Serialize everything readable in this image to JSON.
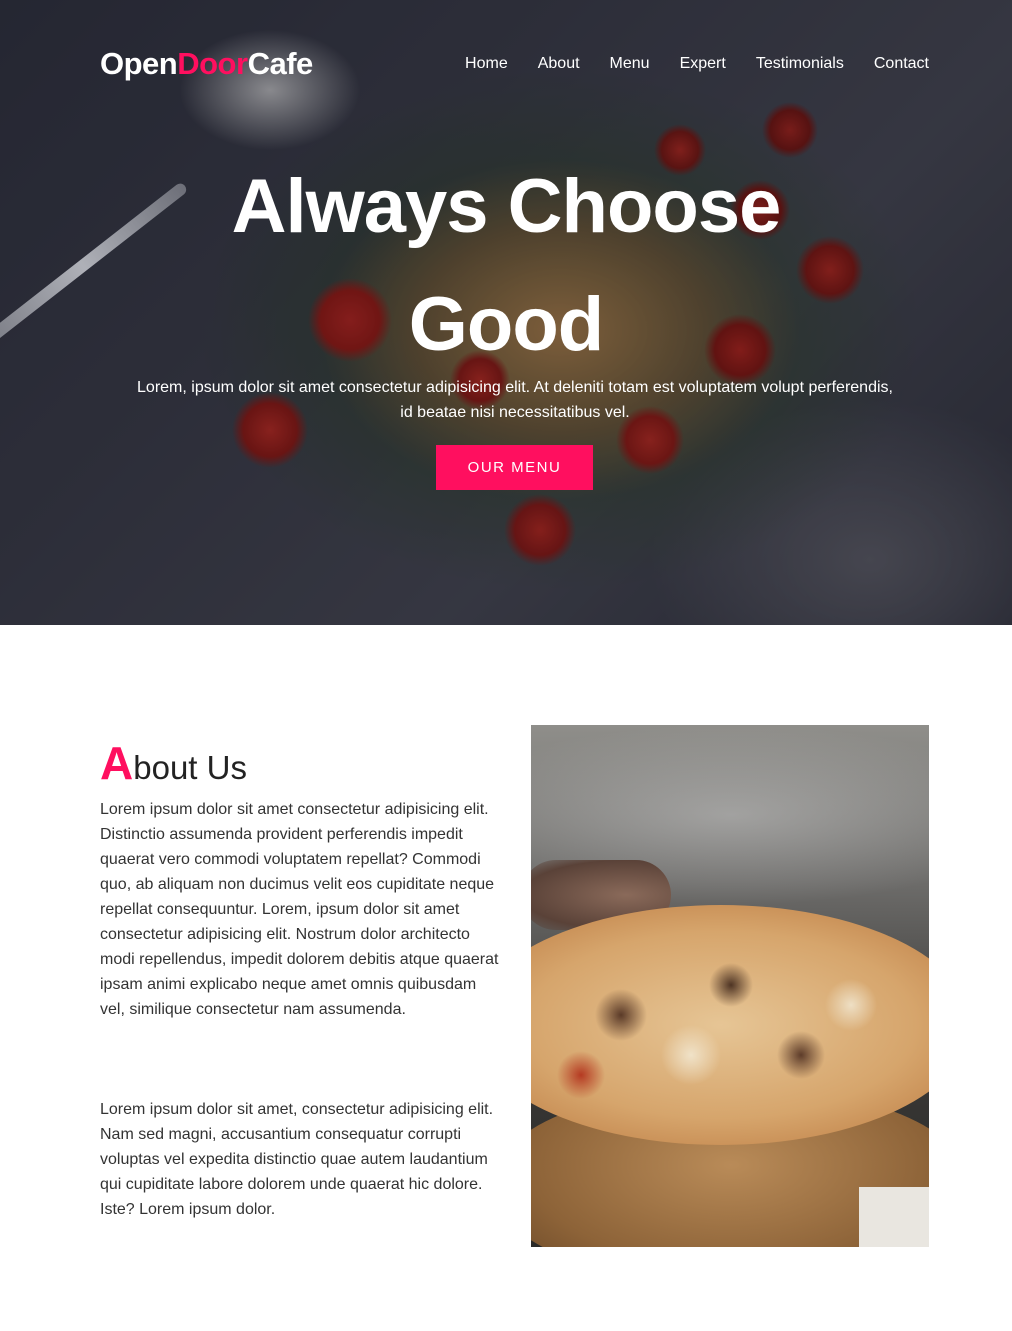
{
  "brand": {
    "part1": "Open",
    "part2": "Door",
    "part3": "Cafe",
    "accent_color": "#ff0f5f"
  },
  "nav": {
    "items": [
      {
        "label": "Home"
      },
      {
        "label": "About"
      },
      {
        "label": "Menu"
      },
      {
        "label": "Expert"
      },
      {
        "label": "Testimonials"
      },
      {
        "label": "Contact"
      }
    ]
  },
  "hero": {
    "title": "Always Choose Good",
    "text": "Lorem, ipsum dolor sit amet consectetur adipisicing elit. At deleniti totam est voluptatem volupt perferendis, id beatae nisi necessitatibus vel.",
    "button": "OUR MENU"
  },
  "about": {
    "title_initial": "A",
    "title_rest": "bout Us",
    "paragraph1": "Lorem ipsum dolor sit amet consectetur adipisicing elit. Distinctio assumenda provident perferendis impedit quaerat vero commodi voluptatem repellat? Commodi quo, ab aliquam non ducimus velit eos cupiditate neque repellat consequuntur. Lorem, ipsum dolor sit amet consectetur adipisicing elit. Nostrum dolor architecto modi repellendus, impedit dolorem debitis atque quaerat ipsam animi explicabo neque amet omnis quibusdam vel, similique consectetur nam assumenda.",
    "paragraph2": "Lorem ipsum dolor sit amet, consectetur adipisicing elit. Nam sed magni, accusantium consequatur corrupti voluptas vel expedita distinctio quae autem laudantium qui cupiditate labore dolorem unde quaerat hic dolore. Iste? Lorem ipsum dolor."
  }
}
